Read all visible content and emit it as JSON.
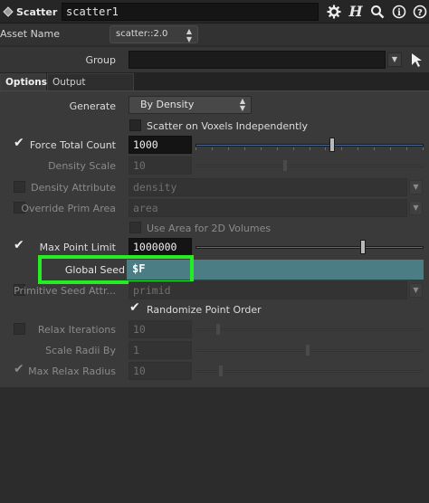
{
  "header": {
    "node_type": "Scatter",
    "node_name": "scatter1",
    "icons": [
      "gear-icon",
      "help-h-icon",
      "search-icon",
      "info-icon",
      "help-question-icon"
    ]
  },
  "asset": {
    "label": "Asset Name",
    "value": "scatter::2.0"
  },
  "group": {
    "label": "Group",
    "value": ""
  },
  "tabs": [
    {
      "label": "Options",
      "active": true
    },
    {
      "label": "Output Attributes",
      "active": false
    }
  ],
  "params": {
    "generate": {
      "label": "Generate",
      "value": "By Density"
    },
    "scatter_voxels": {
      "label": "Scatter on Voxels Independently"
    },
    "force_total_count": {
      "label": "Force Total Count",
      "value": "1000",
      "checked": true,
      "slider_fraction": 0.6
    },
    "density_scale": {
      "label": "Density Scale",
      "value": "10",
      "slider_fraction": 0.39
    },
    "density_attribute": {
      "label": "Density Attribute",
      "value": "density"
    },
    "override_prim_area": {
      "label": "Override Prim Area",
      "value": "area"
    },
    "use_area_2d": {
      "label": "Use Area for 2D Volumes"
    },
    "max_point_limit": {
      "label": "Max Point Limit",
      "value": "1000000",
      "checked": true,
      "slider_fraction": 0.74
    },
    "global_seed": {
      "label": "Global Seed",
      "value": "$F"
    },
    "primitive_seed_attr": {
      "label": "Primitive Seed Attr...",
      "value": "primid"
    },
    "randomize_point_order": {
      "label": "Randomize Point Order",
      "checked": true
    },
    "relax_iterations": {
      "label": "Relax Iterations",
      "value": "10",
      "slider_fraction": 0.09
    },
    "scale_radii_by": {
      "label": "Scale Radii By",
      "value": "1",
      "slider_fraction": 0.49
    },
    "max_relax_radius": {
      "label": "Max Relax Radius",
      "value": "10",
      "checked": true,
      "slider_fraction": 0.1
    }
  },
  "colors": {
    "highlight": "#22ee22",
    "seed_bg": "#4a7d84",
    "slider_active": "#4d6c95"
  }
}
